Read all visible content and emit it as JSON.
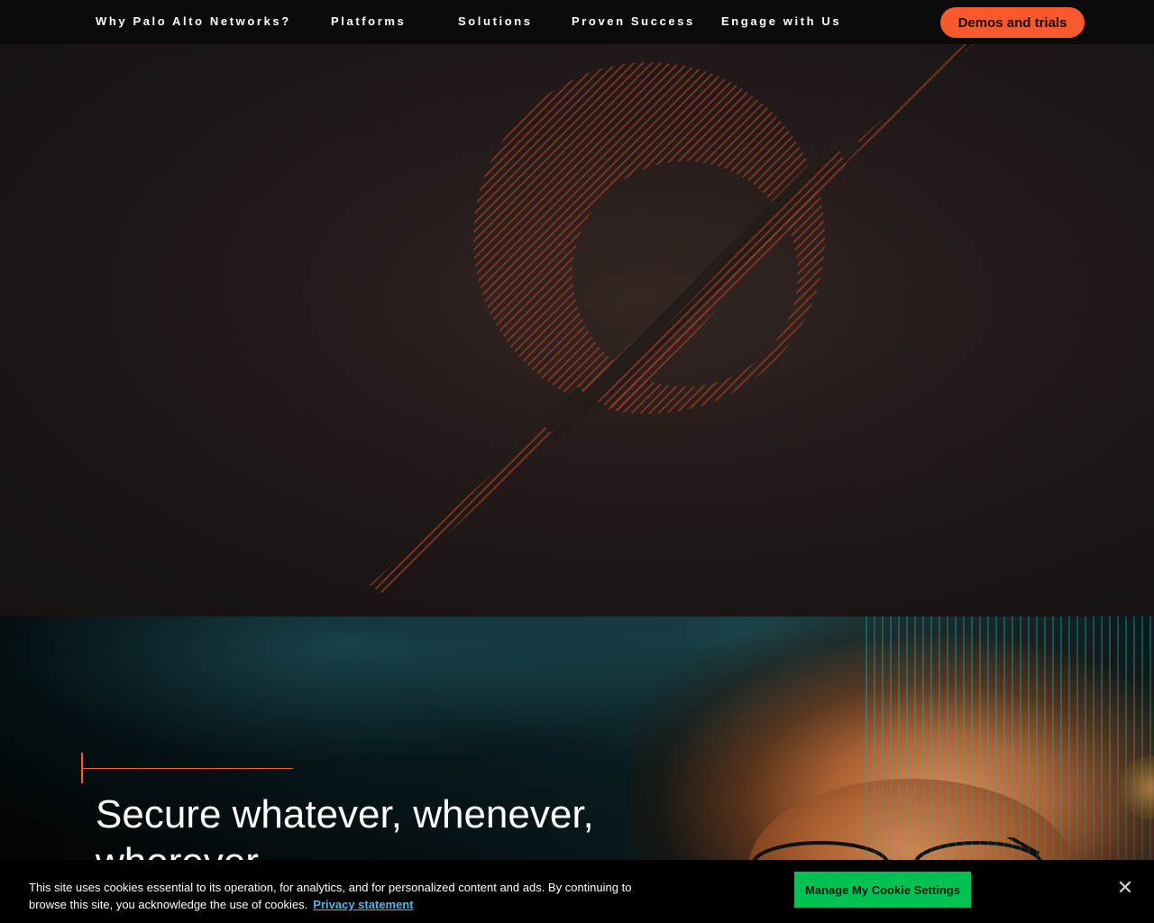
{
  "nav": {
    "items": [
      {
        "label": "Why Palo Alto Networks?"
      },
      {
        "label": "Platforms"
      },
      {
        "label": "Solutions"
      },
      {
        "label": "Proven Success"
      },
      {
        "label": "Engage with Us"
      }
    ],
    "cta_label": "Demos and trials"
  },
  "hero": {
    "headline": "Secure whatever, whenever, wherever."
  },
  "cookie_banner": {
    "text": "This site uses cookies essential to its operation, for analytics, and for personalized content and ads. By continuing to browse this site, you acknowledge the use of cookies.",
    "privacy_link": "Privacy statement",
    "manage_button": "Manage My Cookie Settings",
    "close_icon": "close-icon"
  },
  "colors": {
    "accent": "#fa582d",
    "cookie_button": "#00c253",
    "link": "#4bb8ea",
    "nav_bg": "#0a0a0a"
  }
}
